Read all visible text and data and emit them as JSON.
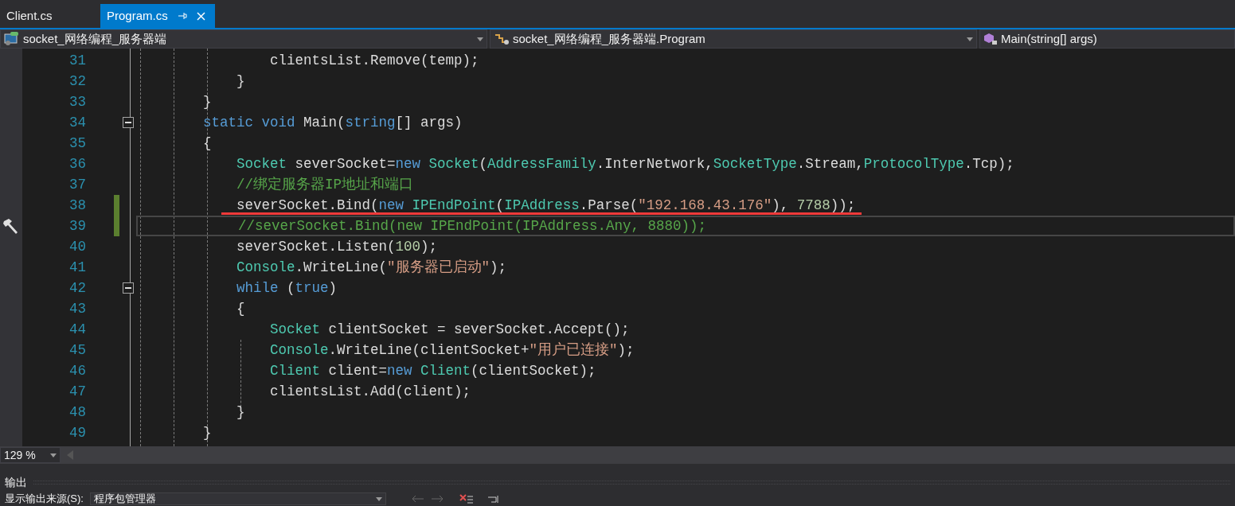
{
  "tabs": [
    {
      "label": "Client.cs",
      "selected": false
    },
    {
      "label": "Program.cs",
      "selected": true
    }
  ],
  "nav_bar": [
    {
      "kind": "project",
      "label": "socket_网络编程_服务器端"
    },
    {
      "kind": "class",
      "label": "socket_网络编程_服务器端.Program"
    },
    {
      "kind": "member",
      "label": "Main(string[] args)"
    }
  ],
  "editor": {
    "lines": [
      {
        "number": "31",
        "changed": false,
        "current": false,
        "tokens": [
          {
            "kind": "plain",
            "text": "                clientsList.Remove(temp);"
          }
        ]
      },
      {
        "number": "32",
        "changed": false,
        "current": false,
        "tokens": [
          {
            "kind": "plain",
            "text": "            }"
          }
        ]
      },
      {
        "number": "33",
        "changed": false,
        "current": false,
        "tokens": [
          {
            "kind": "plain",
            "text": "        }"
          }
        ]
      },
      {
        "number": "34",
        "changed": false,
        "current": false,
        "fold": {
          "expanded": true
        },
        "tokens": [
          {
            "kind": "keyword",
            "text": "        static void "
          },
          {
            "kind": "plain",
            "text": "Main("
          },
          {
            "kind": "keyword",
            "text": "string"
          },
          {
            "kind": "plain",
            "text": "[] args)"
          }
        ]
      },
      {
        "number": "35",
        "changed": false,
        "current": false,
        "tokens": [
          {
            "kind": "plain",
            "text": "        {"
          }
        ]
      },
      {
        "number": "36",
        "changed": false,
        "current": false,
        "tokens": [
          {
            "kind": "type",
            "text": "            Socket"
          },
          {
            "kind": "plain",
            "text": " severSocket="
          },
          {
            "kind": "keyword",
            "text": "new "
          },
          {
            "kind": "type",
            "text": "Socket"
          },
          {
            "kind": "plain",
            "text": "("
          },
          {
            "kind": "type",
            "text": "AddressFamily"
          },
          {
            "kind": "plain",
            "text": ".InterNetwork,"
          },
          {
            "kind": "type",
            "text": "SocketType"
          },
          {
            "kind": "plain",
            "text": ".Stream,"
          },
          {
            "kind": "type",
            "text": "ProtocolType"
          },
          {
            "kind": "plain",
            "text": ".Tcp);"
          }
        ]
      },
      {
        "number": "37",
        "changed": false,
        "current": false,
        "tokens": [
          {
            "kind": "comment",
            "text": "            //绑定服务器IP地址和端口"
          }
        ]
      },
      {
        "number": "38",
        "changed": true,
        "current": false,
        "tokens": [
          {
            "kind": "plain",
            "text": "            severSocket.Bind("
          },
          {
            "kind": "keyword",
            "text": "new "
          },
          {
            "kind": "type",
            "text": "IPEndPoint"
          },
          {
            "kind": "plain",
            "text": "("
          },
          {
            "kind": "type",
            "text": "IPAddress"
          },
          {
            "kind": "plain",
            "text": ".Parse("
          },
          {
            "kind": "string",
            "text": "\"192.168.43.176\""
          },
          {
            "kind": "plain",
            "text": "), "
          },
          {
            "kind": "number",
            "text": "7788"
          },
          {
            "kind": "plain",
            "text": "));"
          }
        ]
      },
      {
        "number": "39",
        "changed": true,
        "current": true,
        "tokens": [
          {
            "kind": "comment",
            "text": "            //severSocket.Bind(new IPEndPoint(IPAddress.Any, 8880));"
          }
        ]
      },
      {
        "number": "40",
        "changed": false,
        "current": false,
        "tokens": [
          {
            "kind": "plain",
            "text": "            severSocket.Listen("
          },
          {
            "kind": "number",
            "text": "100"
          },
          {
            "kind": "plain",
            "text": ");"
          }
        ]
      },
      {
        "number": "41",
        "changed": false,
        "current": false,
        "tokens": [
          {
            "kind": "type",
            "text": "            Console"
          },
          {
            "kind": "plain",
            "text": ".WriteLine("
          },
          {
            "kind": "string",
            "text": "\"服务器已启动\""
          },
          {
            "kind": "plain",
            "text": ");"
          }
        ]
      },
      {
        "number": "42",
        "changed": false,
        "current": false,
        "fold": {
          "expanded": true
        },
        "tokens": [
          {
            "kind": "keyword",
            "text": "            while"
          },
          {
            "kind": "plain",
            "text": " ("
          },
          {
            "kind": "keyword",
            "text": "true"
          },
          {
            "kind": "plain",
            "text": ")"
          }
        ]
      },
      {
        "number": "43",
        "changed": false,
        "current": false,
        "tokens": [
          {
            "kind": "plain",
            "text": "            {"
          }
        ]
      },
      {
        "number": "44",
        "changed": false,
        "current": false,
        "tokens": [
          {
            "kind": "type",
            "text": "                Socket"
          },
          {
            "kind": "plain",
            "text": " clientSocket = severSocket.Accept();"
          }
        ]
      },
      {
        "number": "45",
        "changed": false,
        "current": false,
        "tokens": [
          {
            "kind": "type",
            "text": "                Console"
          },
          {
            "kind": "plain",
            "text": ".WriteLine(clientSocket+"
          },
          {
            "kind": "string",
            "text": "\"用户已连接\""
          },
          {
            "kind": "plain",
            "text": ");"
          }
        ]
      },
      {
        "number": "46",
        "changed": false,
        "current": false,
        "tokens": [
          {
            "kind": "type",
            "text": "                Client"
          },
          {
            "kind": "plain",
            "text": " client="
          },
          {
            "kind": "keyword",
            "text": "new "
          },
          {
            "kind": "type",
            "text": "Client"
          },
          {
            "kind": "plain",
            "text": "(clientSocket);"
          }
        ]
      },
      {
        "number": "47",
        "changed": false,
        "current": false,
        "tokens": [
          {
            "kind": "plain",
            "text": "                clientsList.Add(client);"
          }
        ]
      },
      {
        "number": "48",
        "changed": false,
        "current": false,
        "tokens": [
          {
            "kind": "plain",
            "text": "            }"
          }
        ]
      },
      {
        "number": "49",
        "changed": false,
        "current": false,
        "tokens": [
          {
            "kind": "plain",
            "text": "        }"
          }
        ]
      }
    ]
  },
  "zoom": "129 %",
  "output_panel": {
    "title": "输出",
    "source_label": "显示输出来源(S):",
    "source_value": "程序包管理器"
  }
}
